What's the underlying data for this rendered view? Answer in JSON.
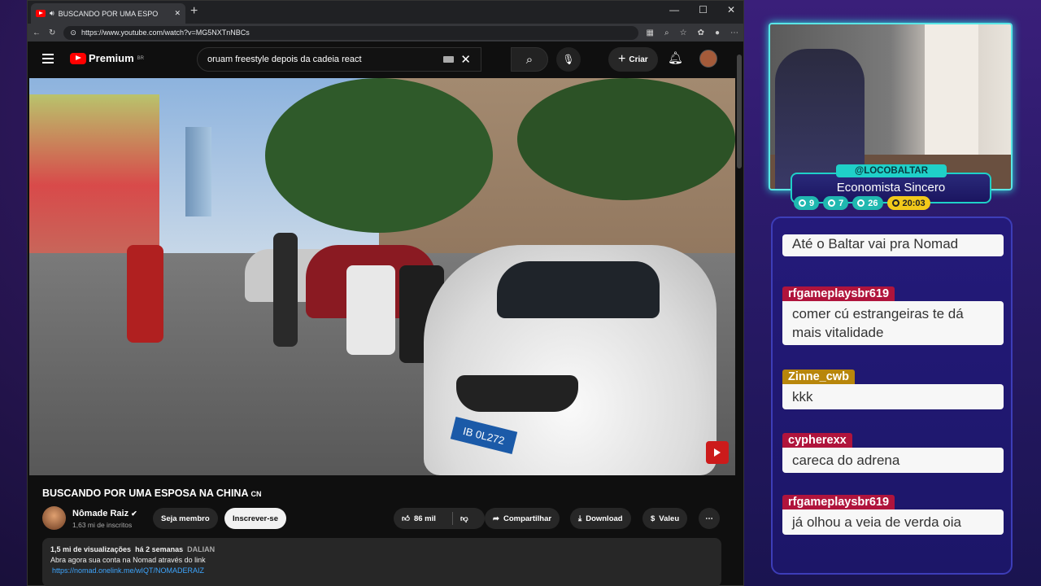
{
  "browser": {
    "tab_title": "BUSCANDO POR UMA ESPO",
    "url": "https://www.youtube.com/watch?v=MG5NXTnNBCs"
  },
  "youtube": {
    "logo_text": "Premium",
    "logo_region": "BR",
    "search_query": "oruam freestyle depois da cadeia react",
    "create_label": "Criar"
  },
  "video": {
    "title": "BUSCANDO POR UMA ESPOSA NA CHINA",
    "title_suffix": "CN",
    "plate": "IB 0L272",
    "channel_name": "Nômade Raiz",
    "channel_subs": "1,63 mi de inscritos",
    "member_label": "Seja membro",
    "subscribe_label": "Inscrever-se",
    "likes": "86 mil",
    "share_label": "Compartilhar",
    "download_label": "Download",
    "thanks_label": "Valeu",
    "description": {
      "views": "1,5 mi de visualizações",
      "age": "há 2 semanas",
      "tag": "DALIAN",
      "line1": "Abra agora sua conta na Nomad através do link",
      "link": "https://nomad.onelink.me/wIQT/NOMADERAIZ"
    }
  },
  "stream": {
    "handle": "@LOCOBALTAR",
    "title": "Economista Sincero",
    "stats": [
      {
        "icon": "twitch-icon",
        "value": "9"
      },
      {
        "icon": "youtube-icon",
        "value": "7"
      },
      {
        "icon": "kick-icon",
        "value": "26"
      },
      {
        "icon": "clock-icon",
        "value": "20:03"
      }
    ]
  },
  "chat": [
    {
      "user": "",
      "text": "Até o Baltar vai pra Nomad",
      "color": "#b0143c"
    },
    {
      "user": "rfgameplaysbr619",
      "text": "comer cú estrangeiras te dá mais vitalidade",
      "color": "#b0143c"
    },
    {
      "user": "Zinne_cwb",
      "text": "kkk",
      "color": "#b8860b"
    },
    {
      "user": "cypherexx",
      "text": "careca do adrena",
      "color": "#b0143c"
    },
    {
      "user": "rfgameplaysbr619",
      "text": "já olhou a veia de verda oia",
      "color": "#b0143c"
    }
  ]
}
